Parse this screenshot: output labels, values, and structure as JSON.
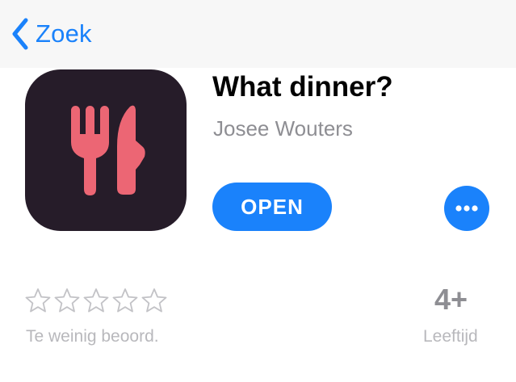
{
  "nav": {
    "back_label": "Zoek",
    "back_icon": "chevron-left-icon"
  },
  "app": {
    "title": "What dinner?",
    "developer": "Josee Wouters",
    "icon": "fork-knife-icon",
    "icon_background": "#261c29",
    "icon_foreground": "#ec6674"
  },
  "actions": {
    "open_label": "OPEN",
    "more_icon": "ellipsis-icon"
  },
  "ratings": {
    "stars_filled": 0,
    "stars_total": 5,
    "caption": "Te weinig beoord."
  },
  "age": {
    "value": "4+",
    "caption": "Leeftijd"
  },
  "colors": {
    "accent": "#1a82fb",
    "secondary_text": "#8e8e93",
    "tertiary_text": "#b8b8bc",
    "nav_background": "#f7f7f7"
  }
}
